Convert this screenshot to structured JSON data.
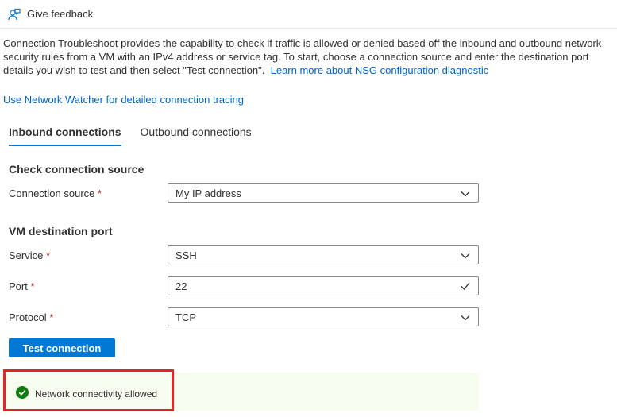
{
  "toolbar": {
    "feedback_label": "Give feedback",
    "feedback_icon": "feedback-person-icon"
  },
  "description": {
    "text": "Connection Troubleshoot provides the capability to check if traffic is allowed or denied based off the inbound and outbound network security rules from a VM with an IPv4 address or service tag. To start, choose a connection source and enter the destination port details you wish to test and then select \"Test connection\".",
    "learn_more": "Learn more about NSG configuration diagnostic"
  },
  "network_watcher_link": "Use Network Watcher for detailed connection tracing",
  "tabs": [
    {
      "label": "Inbound connections",
      "active": true
    },
    {
      "label": "Outbound connections",
      "active": false
    }
  ],
  "source_section": {
    "title": "Check connection source",
    "connection_source": {
      "label": "Connection source",
      "required": "*",
      "value": "My IP address"
    }
  },
  "port_section": {
    "title": "VM destination port",
    "service": {
      "label": "Service",
      "required": "*",
      "value": "SSH"
    },
    "port": {
      "label": "Port",
      "required": "*",
      "value": "22"
    },
    "protocol": {
      "label": "Protocol",
      "required": "*",
      "value": "TCP"
    }
  },
  "test_button_label": "Test connection",
  "result": {
    "text": "Network connectivity allowed",
    "status_color": "#107c10",
    "highlight_color": "#e3242b"
  },
  "colors": {
    "accent": "#0078d4",
    "link": "#0064c8",
    "required": "#a4262c"
  }
}
